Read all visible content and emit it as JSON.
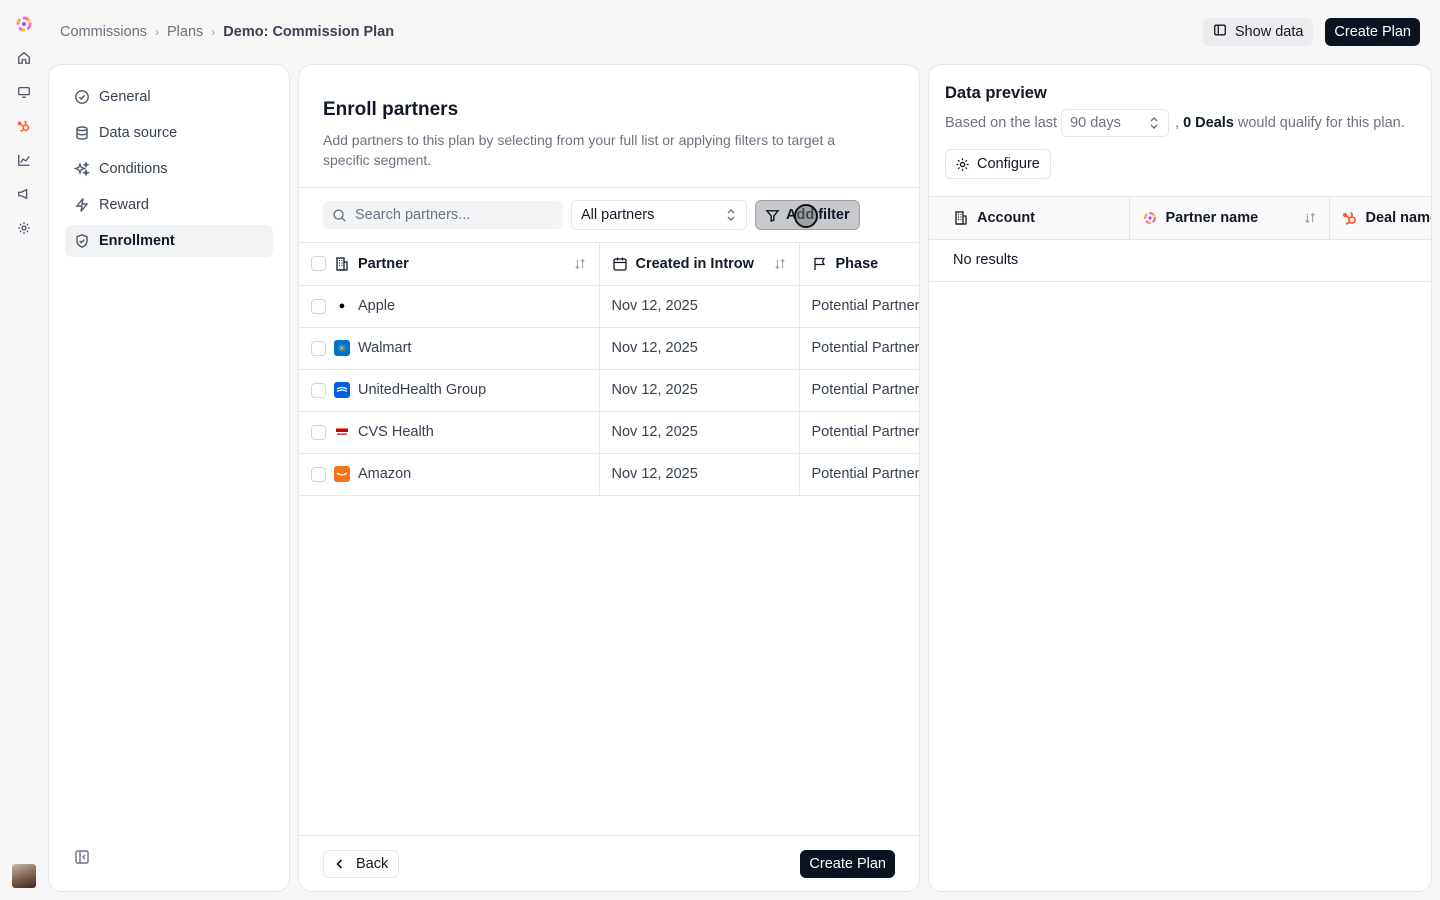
{
  "breadcrumb": {
    "items": [
      "Commissions",
      "Plans"
    ],
    "current": "Demo: Commission Plan"
  },
  "header": {
    "show_data_label": "Show data",
    "create_plan_label": "Create Plan"
  },
  "steps": [
    {
      "label": "General",
      "icon": "check-circle-icon"
    },
    {
      "label": "Data source",
      "icon": "database-icon"
    },
    {
      "label": "Conditions",
      "icon": "sparkles-icon"
    },
    {
      "label": "Reward",
      "icon": "bolt-icon"
    },
    {
      "label": "Enrollment",
      "icon": "shield-check-icon",
      "active": true
    }
  ],
  "enroll": {
    "title": "Enroll partners",
    "description": "Add partners to this plan by selecting from your full list or applying filters to target a specific segment.",
    "search_placeholder": "Search partners...",
    "select_value": "All partners",
    "filter_label": "Add filter",
    "columns": {
      "partner": "Partner",
      "created": "Created in Introw",
      "phase": "Phase"
    },
    "rows": [
      {
        "name": "Apple",
        "created": "Nov 12, 2025",
        "phase": "Potential Partner",
        "logo_color": "#ffffff",
        "logo": "apple-logo-icon"
      },
      {
        "name": "Walmart",
        "created": "Nov 12, 2025",
        "phase": "Potential Partner",
        "logo_color": "#0071ce",
        "logo": "walmart-logo-icon"
      },
      {
        "name": "UnitedHealth Group",
        "created": "Nov 12, 2025",
        "phase": "Potential Partner",
        "logo_color": "#0062e3",
        "logo": "unitedhealth-logo-icon"
      },
      {
        "name": "CVS Health",
        "created": "Nov 12, 2025",
        "phase": "Potential Partner",
        "logo_color": "#ffffff",
        "logo": "cvs-logo-icon"
      },
      {
        "name": "Amazon",
        "created": "Nov 12, 2025",
        "phase": "Potential Partner",
        "logo_color": "#f97316",
        "logo": "amazon-logo-icon"
      }
    ],
    "back_label": "Back",
    "create_plan_label": "Create Plan"
  },
  "preview": {
    "title": "Data preview",
    "based_on": "Based on the last",
    "days_value": "90 days",
    "comma": ",",
    "deals_count": "0 Deals",
    "qualify_text": "would qualify for this plan.",
    "configure_label": "Configure",
    "columns": {
      "account": "Account",
      "partner_name": "Partner name",
      "deal_name": "Deal name"
    },
    "empty": "No results"
  },
  "colors": {
    "primary_dark": "#0b1220",
    "hubspot_orange": "#ff5c35"
  }
}
